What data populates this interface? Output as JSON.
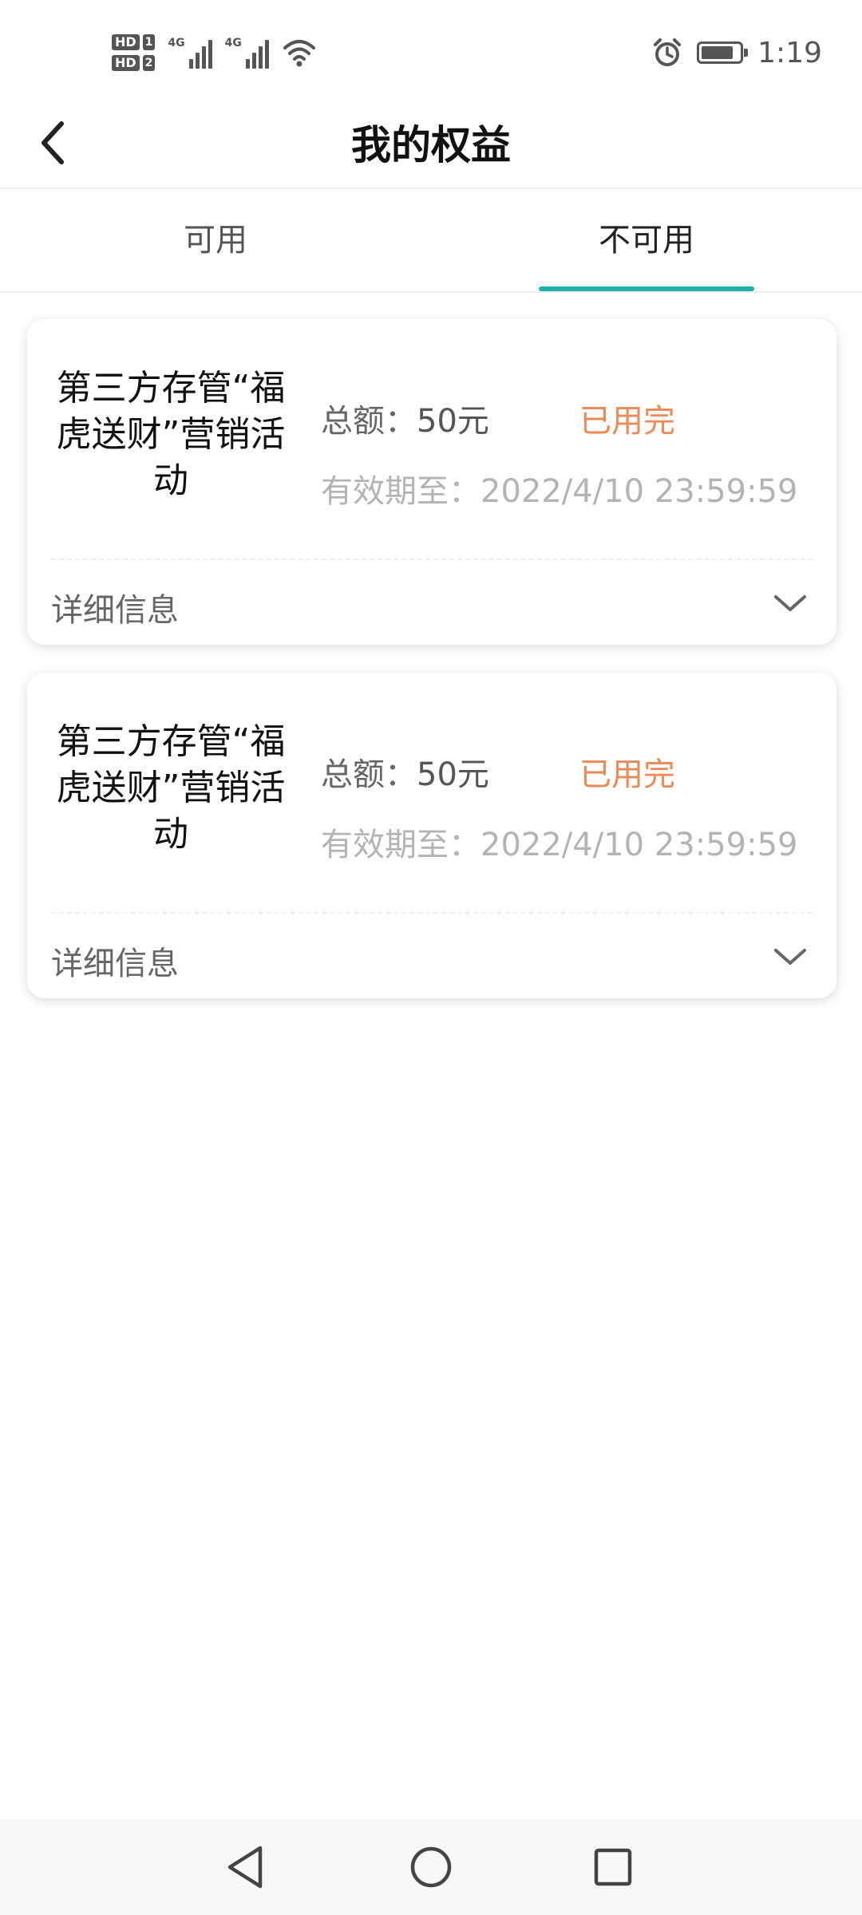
{
  "status_bar": {
    "sim1_label": "HD",
    "sim1_num": "1",
    "sim2_label": "HD",
    "sim2_num": "2",
    "network1": "4G",
    "network2": "4G",
    "battery_level": 0.85,
    "time": "1:19"
  },
  "header": {
    "title": "我的权益"
  },
  "tabs": [
    {
      "label": "可用",
      "active": false
    },
    {
      "label": "不可用",
      "active": true
    }
  ],
  "colors": {
    "accent": "#1fb1a8",
    "used_status": "#ee8a55"
  },
  "cards": [
    {
      "name_lines": [
        "第三方存管“福",
        "虎送财”营销活",
        "动"
      ],
      "amount_label": "总额：",
      "amount_value": "50元",
      "status": "已用完",
      "expiry_label": "有效期至：",
      "expiry_value": "2022/4/10 23:59:59",
      "detail_label": "详细信息"
    },
    {
      "name_lines": [
        "第三方存管“福",
        "虎送财”营销活",
        "动"
      ],
      "amount_label": "总额：",
      "amount_value": "50元",
      "status": "已用完",
      "expiry_label": "有效期至：",
      "expiry_value": "2022/4/10 23:59:59",
      "detail_label": "详细信息"
    }
  ],
  "icons": {
    "back": "chevron-left-icon",
    "expand": "chevron-down-icon",
    "nav_back": "triangle-back-icon",
    "nav_home": "circle-home-icon",
    "nav_recent": "square-recent-icon"
  }
}
